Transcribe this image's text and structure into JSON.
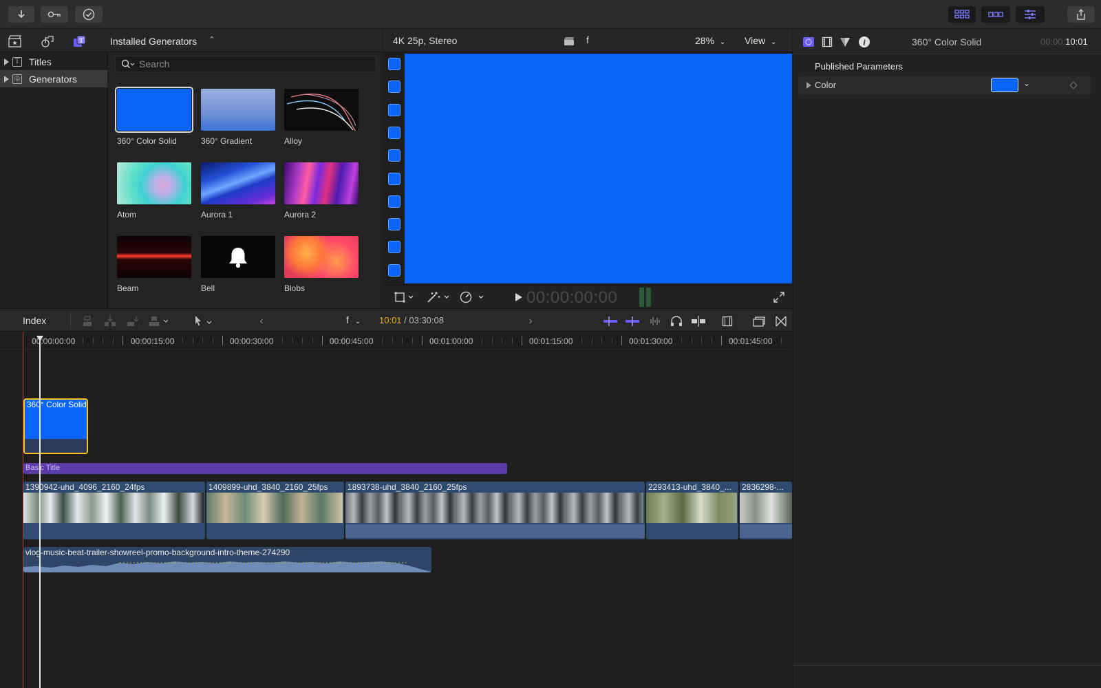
{
  "toolbar": {
    "left_buttons": [
      "import-icon",
      "key-icon",
      "checkmark-icon"
    ],
    "right_buttons": [
      "browser-grid-icon",
      "timeline-icon",
      "inspector-sliders-icon",
      "share-icon"
    ]
  },
  "library": {
    "title": "Installed Generators",
    "sidebar": [
      {
        "label": "Titles",
        "icon": "T"
      },
      {
        "label": "Generators",
        "icon": "◎"
      }
    ],
    "search_placeholder": "Search",
    "generators": [
      {
        "label": "360° Color Solid"
      },
      {
        "label": "360° Gradient"
      },
      {
        "label": "Alloy"
      },
      {
        "label": "Atom"
      },
      {
        "label": "Aurora 1"
      },
      {
        "label": "Aurora 2"
      },
      {
        "label": "Beam"
      },
      {
        "label": "Bell"
      },
      {
        "label": "Blobs"
      }
    ]
  },
  "viewer": {
    "format": "4K 25p, Stereo",
    "clapper_label": "f",
    "zoom": "28%",
    "view_label": "View",
    "timecode": "00:00:00:00",
    "canvas_color": "#0a64fa"
  },
  "inspector": {
    "title": "360° Color Solid",
    "duration_dim": "00:00:",
    "duration": "10:01",
    "section": "Published Parameters",
    "param_label": "Color",
    "color_value": "#0a64fa"
  },
  "timeline": {
    "index_label": "Index",
    "project_label": "f",
    "position": "10:01",
    "total": " / 03:30:08",
    "ruler": [
      "00:00:00:00",
      "00:00:15:00",
      "00:00:30:00",
      "00:00:45:00",
      "00:01:00:00",
      "00:01:15:00",
      "00:01:30:00",
      "00:01:45:00"
    ],
    "connected_clip": "360° Color Solid",
    "title_clip": "Basic Title",
    "primary_clips": [
      "1390942-uhd_4096_2160_24fps",
      "1409899-uhd_3840_2160_25fps",
      "1893738-uhd_3840_2160_25fps",
      "2293413-uhd_3840_...",
      "2836298-..."
    ],
    "audio_clip": "vlog-music-beat-trailer-showreel-promo-background-intro-theme-274290"
  }
}
